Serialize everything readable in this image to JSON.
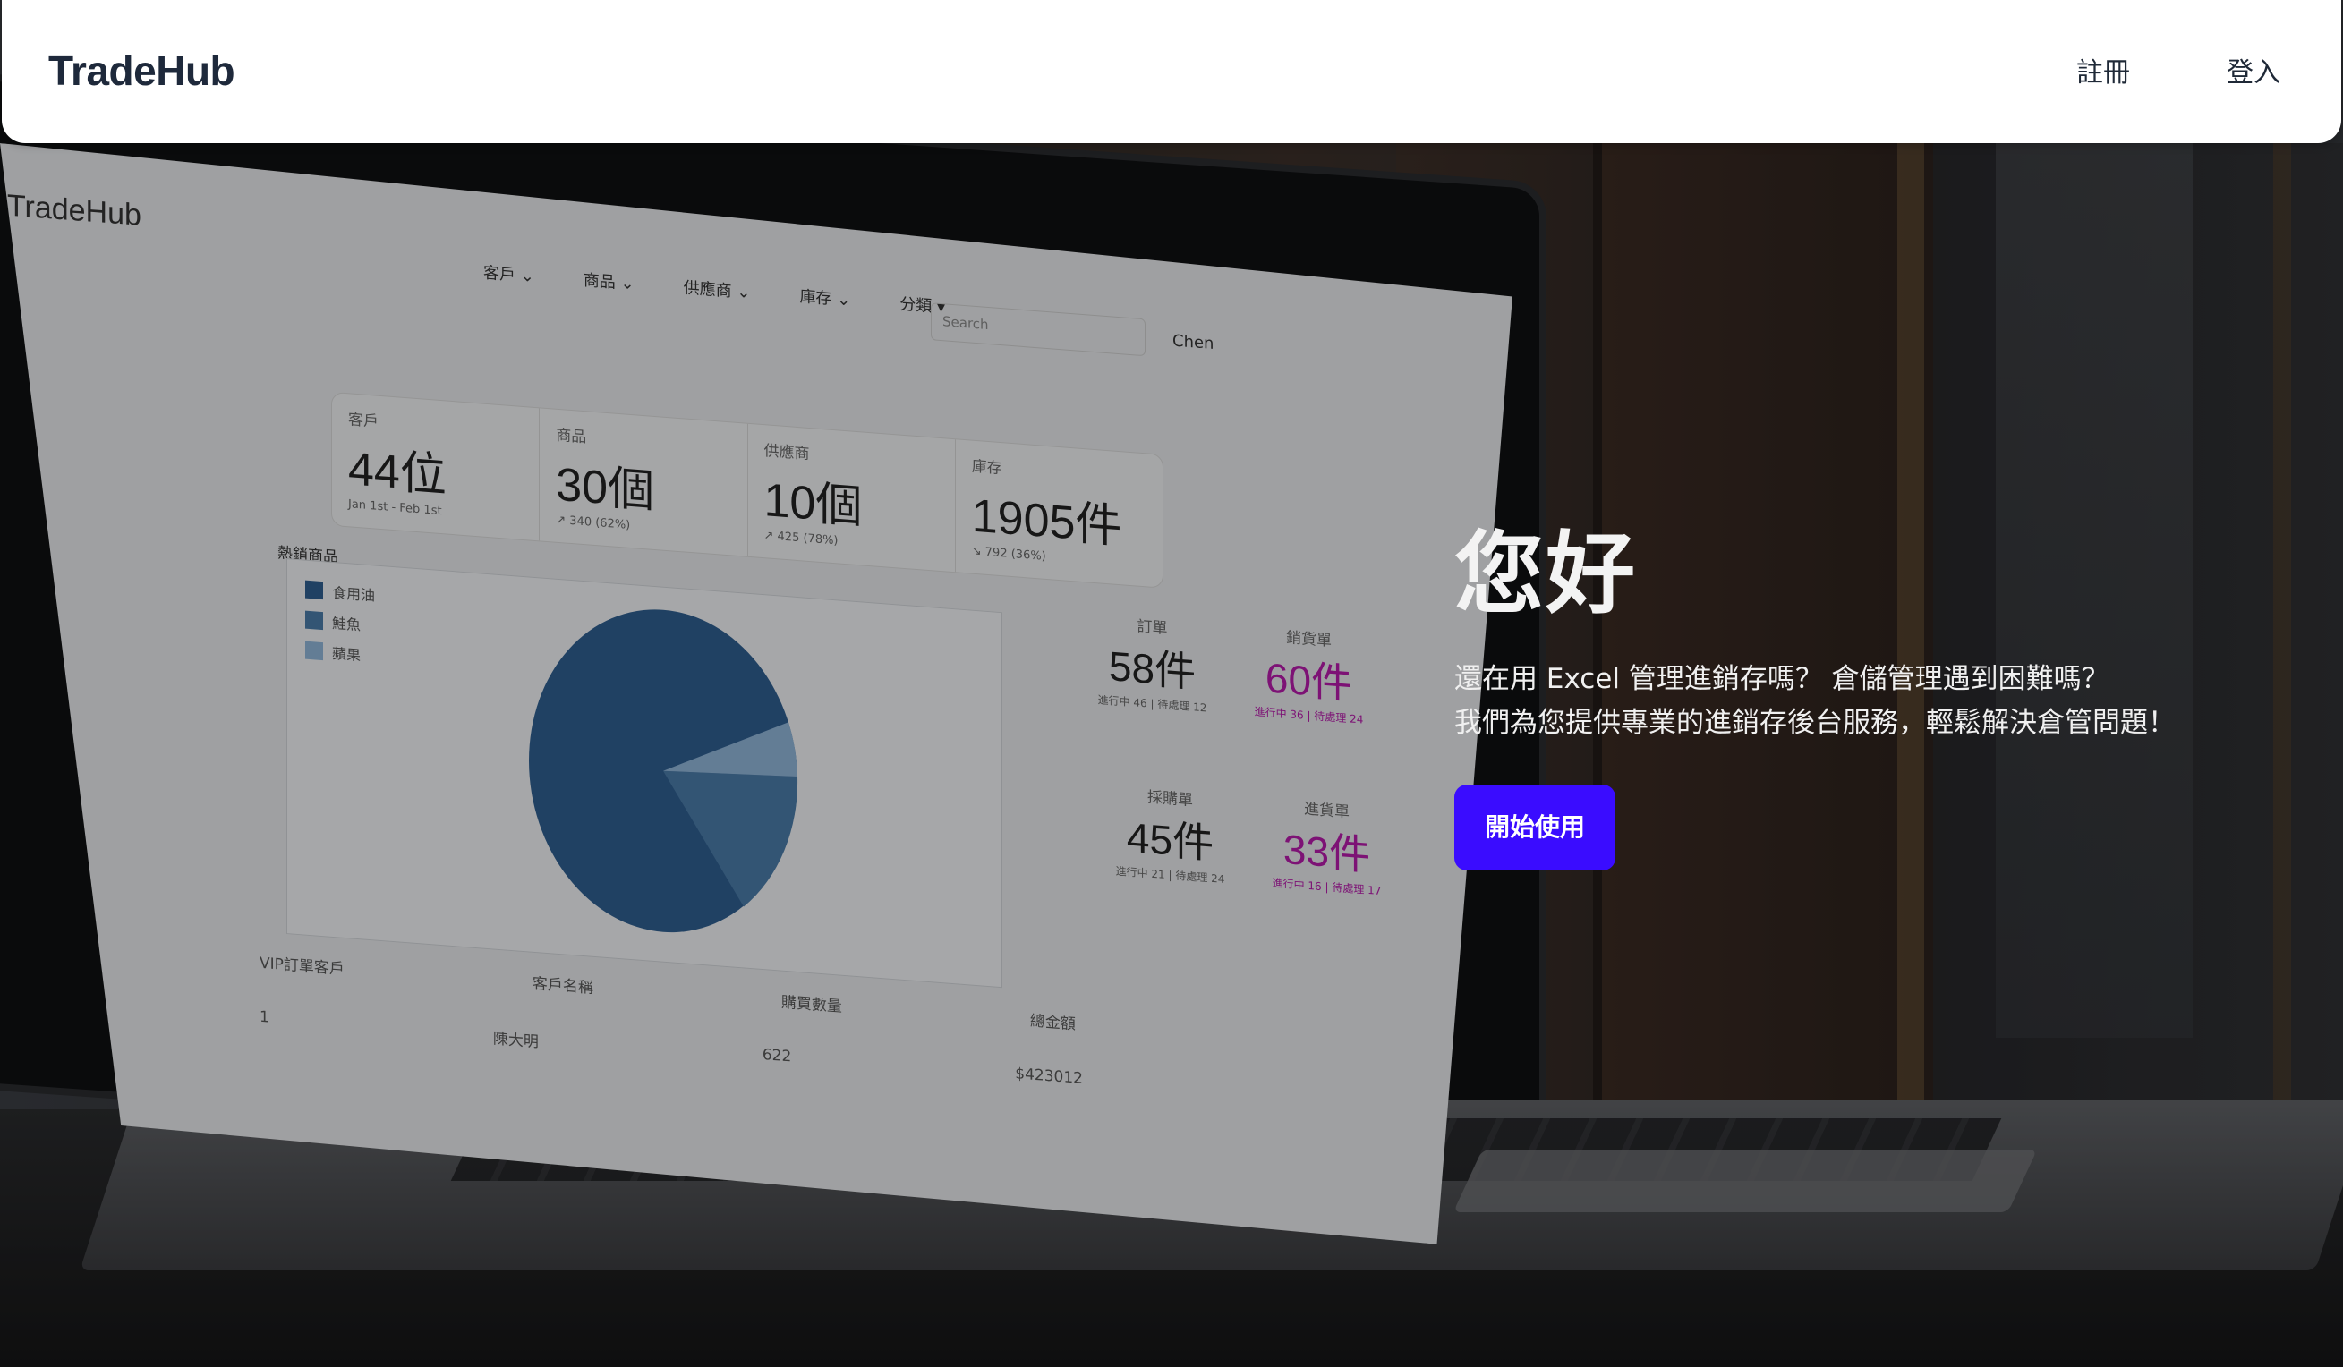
{
  "navbar": {
    "brand": "TradeHub",
    "links": [
      {
        "label": "註冊"
      },
      {
        "label": "登入"
      }
    ]
  },
  "hero": {
    "heading": "您好",
    "subtitle_line1": "還在用 Excel 管理進銷存嗎？ 倉儲管理遇到困難嗎？",
    "subtitle_line2": "我們為您提供專業的進銷存後台服務，輕鬆解決倉管問題！",
    "cta_label": "開始使用",
    "cta_color": "#3a0cff"
  },
  "laptop_screen": {
    "brand": "TradeHub",
    "nav": [
      "客戶 ⌄",
      "商品 ⌄",
      "供應商 ⌄",
      "庫存 ⌄",
      "分類 ▾"
    ],
    "search_placeholder": "Search",
    "user": "Chen",
    "stats": [
      {
        "label": "客戶",
        "value": "44位",
        "sub": "Jan 1st - Feb 1st"
      },
      {
        "label": "商品",
        "value": "30個",
        "sub": "↗ 340 (62%)"
      },
      {
        "label": "供應商",
        "value": "10個",
        "sub": "↗ 425 (78%)"
      },
      {
        "label": "庫存",
        "value": "1905件",
        "sub": "↘ 792 (36%)"
      }
    ],
    "hot_title": "熱銷商品",
    "legend": [
      {
        "name": "食用油",
        "color": "#2f5d8e"
      },
      {
        "name": "鮭魚",
        "color": "#4a7aa6"
      },
      {
        "name": "蘋果",
        "color": "#8eb3d6"
      }
    ],
    "cards": [
      {
        "label": "訂單",
        "value": "58件",
        "sub": "進行中 46 | 待處理 12",
        "color": "#222222"
      },
      {
        "label": "銷貨單",
        "value": "60件",
        "sub": "進行中 36 | 待處理 24",
        "color": "#b31aa8"
      },
      {
        "label": "採購單",
        "value": "45件",
        "sub": "進行中 21 | 待處理 24",
        "color": "#222222"
      },
      {
        "label": "進貨單",
        "value": "33件",
        "sub": "進行中 16 | 待處理 17",
        "color": "#b31aa8"
      }
    ],
    "vip": {
      "title": "VIP訂單客戶",
      "headers": [
        "客戶名稱",
        "購買數量",
        "總金額"
      ],
      "row": [
        "1",
        "陳大明",
        "622",
        "$423012"
      ]
    }
  }
}
